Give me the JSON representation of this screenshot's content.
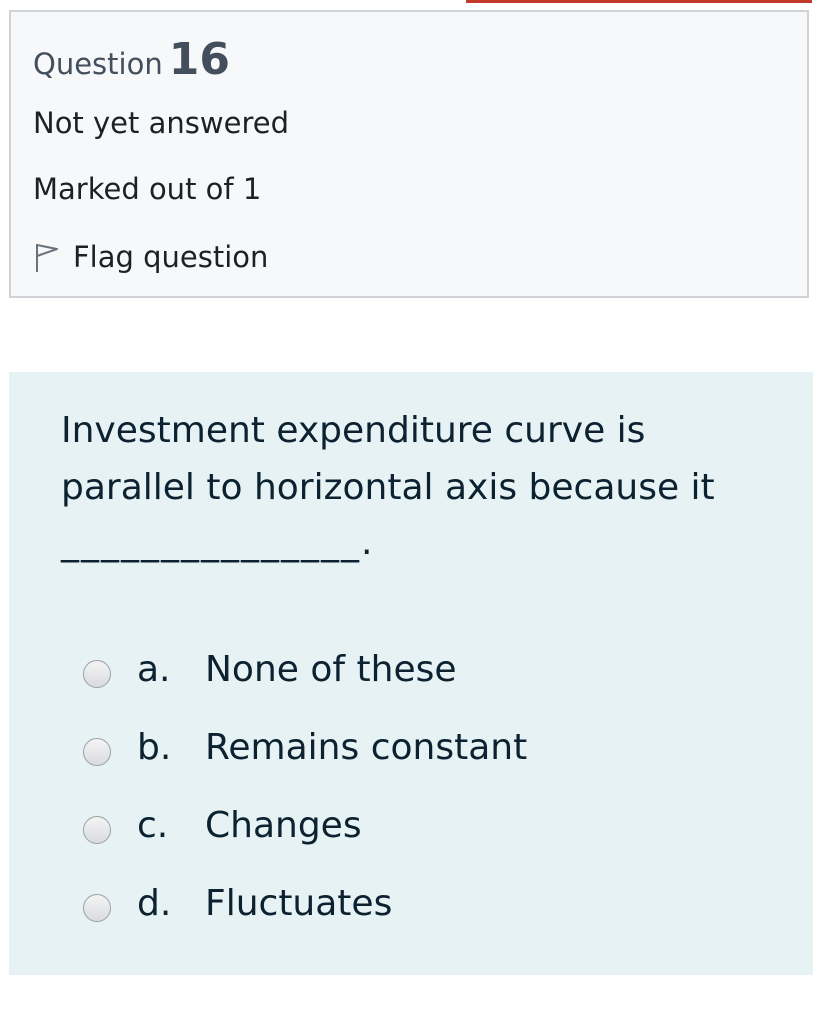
{
  "question_info": {
    "question_label": "Question",
    "question_number": "16",
    "state": "Not yet answered",
    "grade": "Marked out of 1",
    "flag_label": "Flag question",
    "flag_icon": "flag-outline-icon"
  },
  "question": {
    "text": "Investment expenditure curve is parallel to horizontal axis because it",
    "blank": "_______________."
  },
  "answers": [
    {
      "letter": "a.",
      "text": "None of these",
      "selected": false
    },
    {
      "letter": "b.",
      "text": "Remains constant",
      "selected": false
    },
    {
      "letter": "c.",
      "text": "Changes",
      "selected": false
    },
    {
      "letter": "d.",
      "text": "Fluctuates",
      "selected": false
    }
  ],
  "colors": {
    "accent": "#c0392b",
    "content_background": "#e6f2f4",
    "info_background": "#f7f8fa"
  }
}
